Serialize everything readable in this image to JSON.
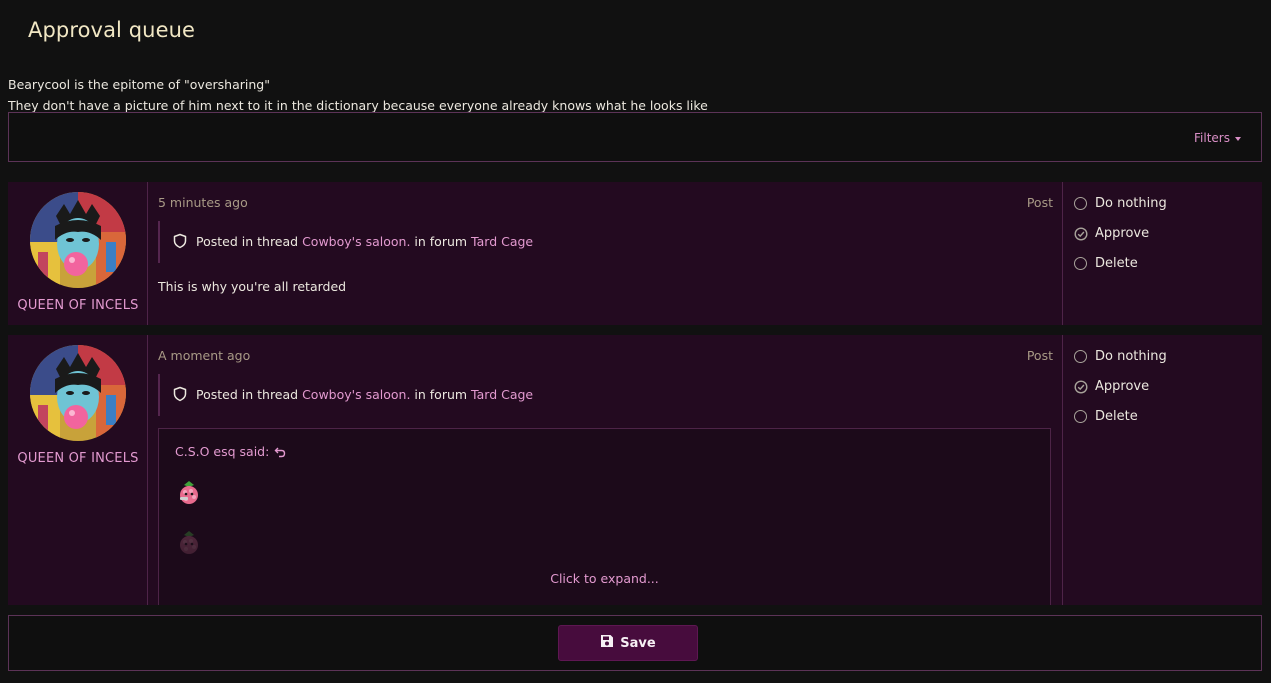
{
  "page": {
    "title": "Approval queue"
  },
  "notice": {
    "line1": "Bearycool is the epitome of \"oversharing\"",
    "line2": "They don't have a picture of him next to it in the dictionary because everyone already knows what he looks like"
  },
  "filters": {
    "label": "Filters"
  },
  "items": [
    {
      "username": "QUEEN OF INCELS",
      "time": "5 minutes ago",
      "content_type": "Post",
      "context": {
        "prefix": "Posted in thread",
        "thread": "Cowboy's saloon.",
        "mid": "in forum",
        "forum": "Tard Cage"
      },
      "message": "This is why you're all retarded",
      "actions": [
        "Do nothing",
        "Approve",
        "Delete"
      ]
    },
    {
      "username": "QUEEN OF INCELS",
      "time": "A moment ago",
      "content_type": "Post",
      "context": {
        "prefix": "Posted in thread",
        "thread": "Cowboy's saloon.",
        "mid": "in forum",
        "forum": "Tard Cage"
      },
      "quote": {
        "author": "C.S.O esq said:",
        "expand": "Click to expand..."
      },
      "actions": [
        "Do nothing",
        "Approve",
        "Delete"
      ]
    }
  ],
  "footer": {
    "save_label": "Save"
  },
  "colors": {
    "accent": "#e39ad0",
    "item_bg": "#230a20",
    "button_bg": "#470c3d",
    "title": "#f1e7c4"
  }
}
